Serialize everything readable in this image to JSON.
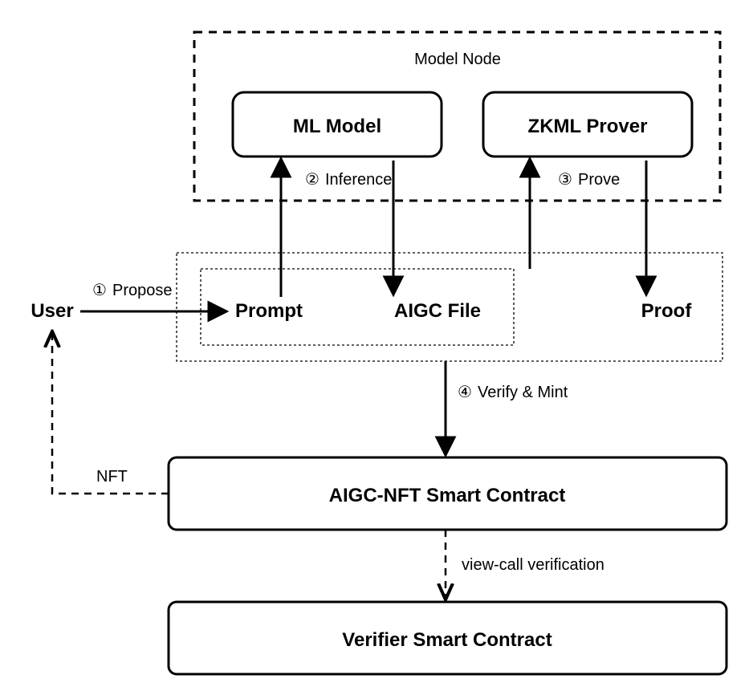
{
  "nodes": {
    "user": "User",
    "model_node": "Model Node",
    "ml_model": "ML Model",
    "zkml_prover": "ZKML Prover",
    "prompt": "Prompt",
    "aigc_file": "AIGC File",
    "proof": "Proof",
    "aigc_nft_contract": "AIGC-NFT Smart Contract",
    "verifier_contract": "Verifier Smart Contract"
  },
  "edges": {
    "propose": {
      "num": "①",
      "label": "Propose"
    },
    "inference": {
      "num": "②",
      "label": "Inference"
    },
    "prove": {
      "num": "③",
      "label": "Prove"
    },
    "verify_mint": {
      "num": "④",
      "label": "Verify & Mint"
    },
    "nft": "NFT",
    "view_call": "view-call verification"
  }
}
